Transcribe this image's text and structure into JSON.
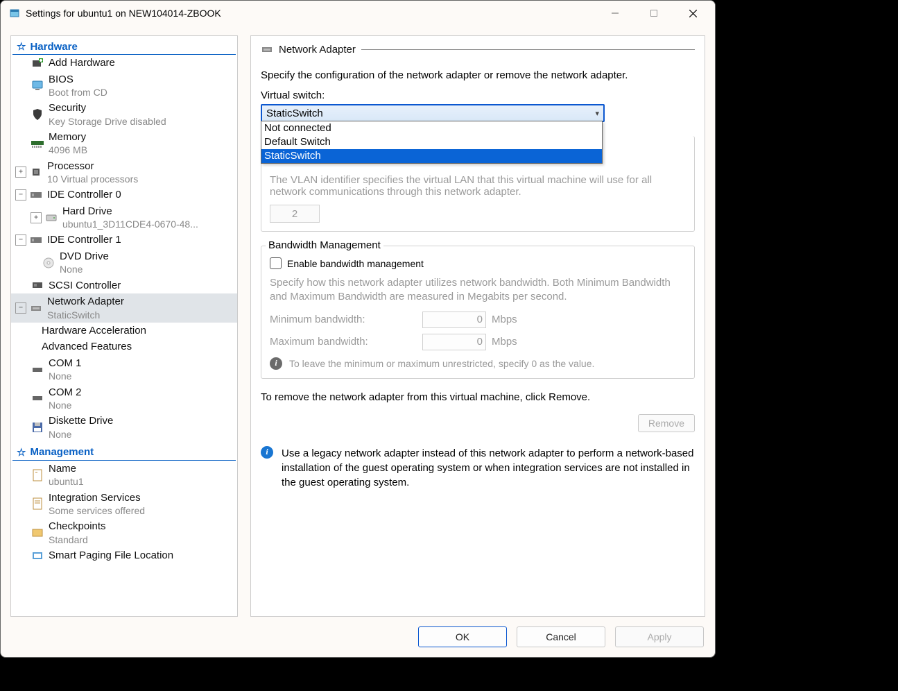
{
  "window": {
    "title": "Settings for ubuntu1 on NEW104014-ZBOOK"
  },
  "sidebar": {
    "hardware_header": "Hardware",
    "management_header": "Management",
    "items": {
      "add_hardware": {
        "label": "Add Hardware"
      },
      "bios": {
        "label": "BIOS",
        "sub": "Boot from CD"
      },
      "security": {
        "label": "Security",
        "sub": "Key Storage Drive disabled"
      },
      "memory": {
        "label": "Memory",
        "sub": "4096 MB"
      },
      "processor": {
        "label": "Processor",
        "sub": "10 Virtual processors"
      },
      "ide0": {
        "label": "IDE Controller 0"
      },
      "hard_drive": {
        "label": "Hard Drive",
        "sub": "ubuntu1_3D11CDE4-0670-48..."
      },
      "ide1": {
        "label": "IDE Controller 1"
      },
      "dvd": {
        "label": "DVD Drive",
        "sub": "None"
      },
      "scsi": {
        "label": "SCSI Controller"
      },
      "network": {
        "label": "Network Adapter",
        "sub": "StaticSwitch"
      },
      "hw_accel": {
        "label": "Hardware Acceleration"
      },
      "adv_feat": {
        "label": "Advanced Features"
      },
      "com1": {
        "label": "COM 1",
        "sub": "None"
      },
      "com2": {
        "label": "COM 2",
        "sub": "None"
      },
      "diskette": {
        "label": "Diskette Drive",
        "sub": "None"
      },
      "name": {
        "label": "Name",
        "sub": "ubuntu1"
      },
      "integration": {
        "label": "Integration Services",
        "sub": "Some services offered"
      },
      "checkpoints": {
        "label": "Checkpoints",
        "sub": "Standard"
      },
      "smart_paging": {
        "label": "Smart Paging File Location"
      }
    }
  },
  "main": {
    "panel_title": "Network Adapter",
    "description": "Specify the configuration of the network adapter or remove the network adapter.",
    "switch_label": "Virtual switch:",
    "combo": {
      "selected": "StaticSwitch",
      "options": [
        "Not connected",
        "Default Switch",
        "StaticSwitch"
      ]
    },
    "vlan": {
      "help": "The VLAN identifier specifies the virtual LAN that this virtual machine will use for all network communications through this network adapter.",
      "value": "2"
    },
    "bandwidth": {
      "legend": "Bandwidth Management",
      "enable_label": "Enable bandwidth management",
      "help": "Specify how this network adapter utilizes network bandwidth. Both Minimum Bandwidth and Maximum Bandwidth are measured in Megabits per second.",
      "min_label": "Minimum bandwidth:",
      "min_value": "0",
      "max_label": "Maximum bandwidth:",
      "max_value": "0",
      "unit": "Mbps",
      "tip": "To leave the minimum or maximum unrestricted, specify 0 as the value."
    },
    "remove_text": "To remove the network adapter from this virtual machine, click Remove.",
    "remove_btn": "Remove",
    "legacy_note": "Use a legacy network adapter instead of this network adapter to perform a network-based installation of the guest operating system or when integration services are not installed in the guest operating system."
  },
  "buttons": {
    "ok": "OK",
    "cancel": "Cancel",
    "apply": "Apply"
  }
}
